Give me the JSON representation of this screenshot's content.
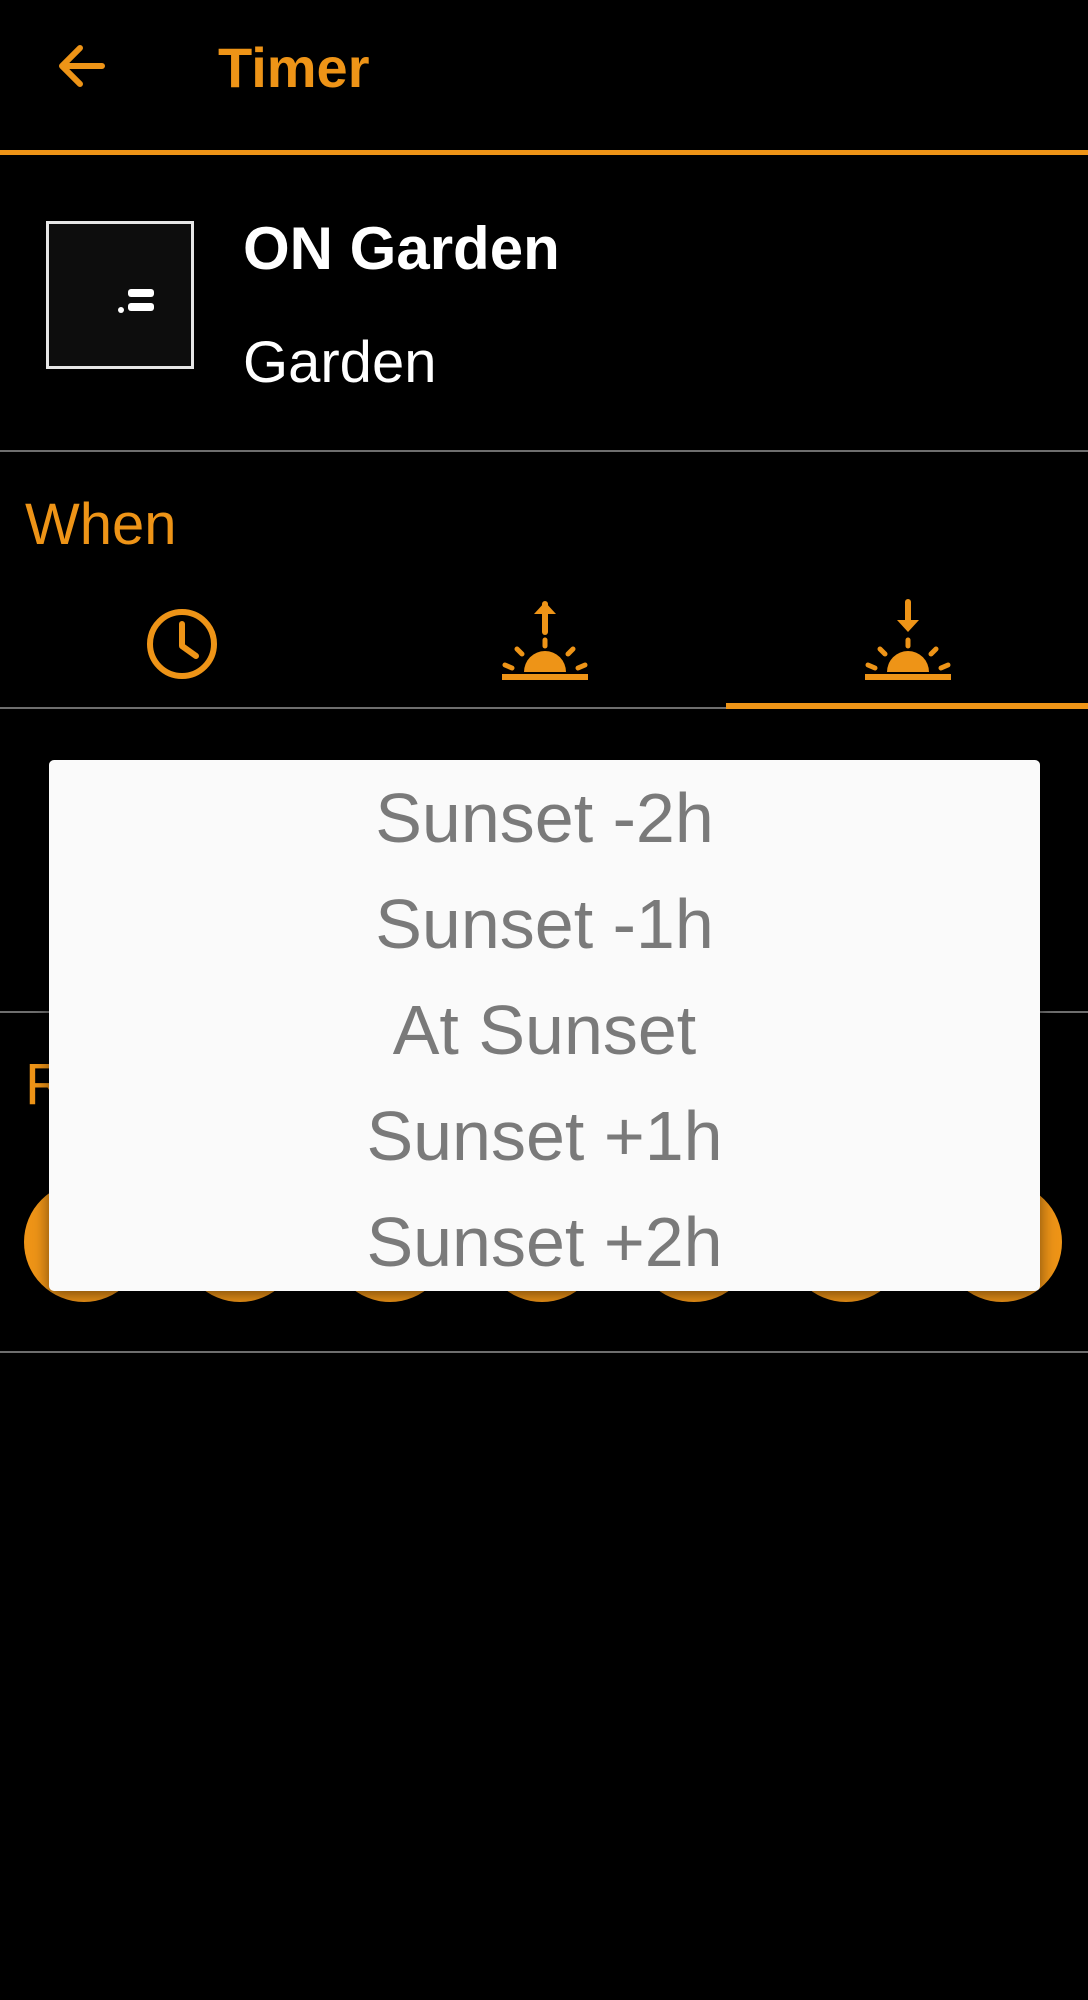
{
  "header": {
    "title": "Timer"
  },
  "device": {
    "name": "ON Garden",
    "room": "Garden",
    "icon": "switch-icon"
  },
  "when": {
    "label": "When",
    "tabs": [
      {
        "name": "time-of-day",
        "icon": "clock-icon"
      },
      {
        "name": "sunrise",
        "icon": "sunrise-icon"
      },
      {
        "name": "sunset",
        "icon": "sunset-icon",
        "selected": true
      }
    ]
  },
  "repeat": {
    "label_visible": "R"
  },
  "popup": {
    "options": [
      "Sunset -2h",
      "Sunset -1h",
      "At Sunset",
      "Sunset +1h",
      "Sunset +2h"
    ]
  },
  "colors": {
    "accent": "#EE9417",
    "background": "#000000",
    "popup_bg": "#FAFAFA",
    "option_text": "#7A7A7A"
  }
}
